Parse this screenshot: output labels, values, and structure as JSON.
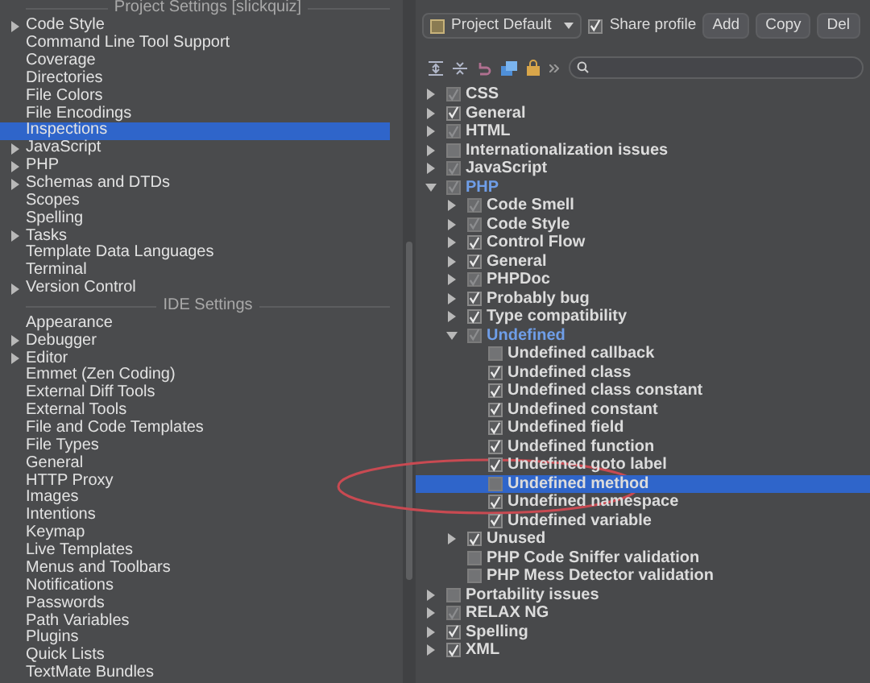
{
  "sidebar": {
    "sections": [
      {
        "title": "Project Settings [slickquiz]",
        "items": [
          {
            "label": "Code Style",
            "expanded": false,
            "selected": false
          },
          {
            "label": "Command Line Tool Support",
            "selected": false
          },
          {
            "label": "Coverage",
            "selected": false
          },
          {
            "label": "Directories",
            "selected": false
          },
          {
            "label": "File Colors",
            "selected": false
          },
          {
            "label": "File Encodings",
            "selected": false
          },
          {
            "label": "Inspections",
            "selected": true
          },
          {
            "label": "JavaScript",
            "expanded": false,
            "selected": false
          },
          {
            "label": "PHP",
            "expanded": false,
            "selected": false
          },
          {
            "label": "Schemas and DTDs",
            "expanded": false,
            "selected": false
          },
          {
            "label": "Scopes",
            "selected": false
          },
          {
            "label": "Spelling",
            "selected": false
          },
          {
            "label": "Tasks",
            "expanded": false,
            "selected": false
          },
          {
            "label": "Template Data Languages",
            "selected": false
          },
          {
            "label": "Terminal",
            "selected": false
          },
          {
            "label": "Version Control",
            "expanded": false,
            "selected": false
          }
        ]
      },
      {
        "title": "IDE Settings",
        "items": [
          {
            "label": "Appearance",
            "selected": false
          },
          {
            "label": "Debugger",
            "expanded": false,
            "selected": false
          },
          {
            "label": "Editor",
            "expanded": false,
            "selected": false
          },
          {
            "label": "Emmet (Zen Coding)",
            "selected": false
          },
          {
            "label": "External Diff Tools",
            "selected": false
          },
          {
            "label": "External Tools",
            "selected": false
          },
          {
            "label": "File and Code Templates",
            "selected": false
          },
          {
            "label": "File Types",
            "selected": false
          },
          {
            "label": "General",
            "selected": false
          },
          {
            "label": "HTTP Proxy",
            "selected": false
          },
          {
            "label": "Images",
            "selected": false
          },
          {
            "label": "Intentions",
            "selected": false
          },
          {
            "label": "Keymap",
            "selected": false
          },
          {
            "label": "Live Templates",
            "selected": false
          },
          {
            "label": "Menus and Toolbars",
            "selected": false
          },
          {
            "label": "Notifications",
            "selected": false
          },
          {
            "label": "Passwords",
            "selected": false
          },
          {
            "label": "Path Variables",
            "selected": false
          },
          {
            "label": "Plugins",
            "selected": false
          },
          {
            "label": "Quick Lists",
            "selected": false
          },
          {
            "label": "TextMate Bundles",
            "selected": false
          }
        ]
      }
    ]
  },
  "profile_bar": {
    "profile": "Project Default",
    "share_profile": {
      "label": "Share profile",
      "checked": true
    },
    "buttons": [
      "Add",
      "Copy",
      "Del"
    ]
  },
  "inspections": [
    {
      "label": "CSS",
      "expanded": false,
      "checked": true,
      "indeterminate": true,
      "modified": false,
      "selected": false
    },
    {
      "label": "General",
      "expanded": false,
      "checked": true,
      "indeterminate": false,
      "modified": false,
      "selected": false
    },
    {
      "label": "HTML",
      "expanded": false,
      "checked": true,
      "indeterminate": true,
      "modified": false,
      "selected": false
    },
    {
      "label": "Internationalization issues",
      "expanded": false,
      "checked": false,
      "modified": false,
      "selected": false
    },
    {
      "label": "JavaScript",
      "expanded": false,
      "checked": true,
      "indeterminate": true,
      "modified": false,
      "selected": false
    },
    {
      "label": "PHP",
      "expanded": true,
      "checked": true,
      "indeterminate": true,
      "modified": true,
      "selected": false,
      "children": [
        {
          "label": "Code Smell",
          "expanded": false,
          "checked": true,
          "indeterminate": true,
          "modified": false,
          "selected": false
        },
        {
          "label": "Code Style",
          "expanded": false,
          "checked": true,
          "indeterminate": true,
          "modified": false,
          "selected": false
        },
        {
          "label": "Control Flow",
          "expanded": false,
          "checked": true,
          "indeterminate": false,
          "modified": false,
          "selected": false
        },
        {
          "label": "General",
          "expanded": false,
          "checked": true,
          "indeterminate": false,
          "modified": false,
          "selected": false
        },
        {
          "label": "PHPDoc",
          "expanded": false,
          "checked": true,
          "indeterminate": true,
          "modified": false,
          "selected": false
        },
        {
          "label": "Probably bug",
          "expanded": false,
          "checked": true,
          "indeterminate": false,
          "modified": false,
          "selected": false
        },
        {
          "label": "Type compatibility",
          "expanded": false,
          "checked": true,
          "indeterminate": false,
          "modified": false,
          "selected": false
        },
        {
          "label": "Undefined",
          "expanded": true,
          "checked": true,
          "indeterminate": true,
          "modified": true,
          "selected": false,
          "children": [
            {
              "label": "Undefined callback",
              "checked": false,
              "modified": false,
              "selected": false
            },
            {
              "label": "Undefined class",
              "checked": true,
              "indeterminate": false,
              "modified": false,
              "selected": false
            },
            {
              "label": "Undefined class constant",
              "checked": true,
              "indeterminate": false,
              "modified": false,
              "selected": false
            },
            {
              "label": "Undefined constant",
              "checked": true,
              "indeterminate": false,
              "modified": false,
              "selected": false
            },
            {
              "label": "Undefined field",
              "checked": true,
              "indeterminate": false,
              "modified": false,
              "selected": false
            },
            {
              "label": "Undefined function",
              "checked": true,
              "indeterminate": false,
              "modified": false,
              "selected": false
            },
            {
              "label": "Undefined goto label",
              "checked": true,
              "indeterminate": false,
              "modified": false,
              "selected": false
            },
            {
              "label": "Undefined method",
              "checked": false,
              "modified": false,
              "selected": true
            },
            {
              "label": "Undefined namespace",
              "checked": true,
              "indeterminate": false,
              "modified": false,
              "selected": false
            },
            {
              "label": "Undefined variable",
              "checked": true,
              "indeterminate": false,
              "modified": false,
              "selected": false
            }
          ]
        },
        {
          "label": "Unused",
          "expanded": false,
          "checked": true,
          "indeterminate": false,
          "modified": false,
          "selected": false
        },
        {
          "label": "PHP Code Sniffer validation",
          "checked": false,
          "modified": false,
          "selected": false
        },
        {
          "label": "PHP Mess Detector validation",
          "checked": false,
          "modified": false,
          "selected": false
        }
      ]
    },
    {
      "label": "Portability issues",
      "expanded": false,
      "checked": false,
      "modified": false,
      "selected": false
    },
    {
      "label": "RELAX NG",
      "expanded": false,
      "checked": true,
      "indeterminate": true,
      "modified": false,
      "selected": false
    },
    {
      "label": "Spelling",
      "expanded": false,
      "checked": true,
      "indeterminate": false,
      "modified": false,
      "selected": false
    },
    {
      "label": "XML",
      "expanded": false,
      "checked": true,
      "indeterminate": false,
      "modified": false,
      "selected": false
    }
  ]
}
